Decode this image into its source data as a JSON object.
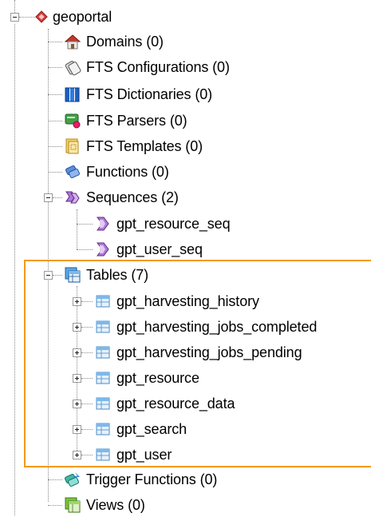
{
  "tree": {
    "root": {
      "label": "geoportal",
      "icon": "database-icon"
    },
    "children": [
      {
        "label": "Domains (0)",
        "icon": "domains-icon"
      },
      {
        "label": "FTS Configurations (0)",
        "icon": "fts-configurations-icon"
      },
      {
        "label": "FTS Dictionaries (0)",
        "icon": "fts-dictionaries-icon"
      },
      {
        "label": "FTS Parsers (0)",
        "icon": "fts-parsers-icon"
      },
      {
        "label": "FTS Templates (0)",
        "icon": "fts-templates-icon"
      },
      {
        "label": "Functions (0)",
        "icon": "functions-icon"
      },
      {
        "label": "Sequences (2)",
        "icon": "sequences-icon",
        "children": [
          {
            "label": "gpt_resource_seq",
            "icon": "sequence-icon"
          },
          {
            "label": "gpt_user_seq",
            "icon": "sequence-icon"
          }
        ]
      },
      {
        "label": "Tables (7)",
        "icon": "tables-icon",
        "children": [
          {
            "label": "gpt_harvesting_history",
            "icon": "table-icon"
          },
          {
            "label": "gpt_harvesting_jobs_completed",
            "icon": "table-icon"
          },
          {
            "label": "gpt_harvesting_jobs_pending",
            "icon": "table-icon"
          },
          {
            "label": "gpt_resource",
            "icon": "table-icon"
          },
          {
            "label": "gpt_resource_data",
            "icon": "table-icon"
          },
          {
            "label": "gpt_search",
            "icon": "table-icon"
          },
          {
            "label": "gpt_user",
            "icon": "table-icon"
          }
        ]
      },
      {
        "label": "Trigger Functions (0)",
        "icon": "trigger-functions-icon"
      },
      {
        "label": "Views (0)",
        "icon": "views-icon"
      }
    ]
  },
  "colors": {
    "highlight_border": "#f29a1d",
    "guide_lines": "#8a8a8a"
  }
}
